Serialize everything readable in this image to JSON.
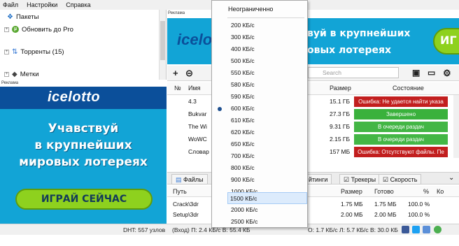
{
  "menu": [
    "Файл",
    "Настройки",
    "Справка"
  ],
  "sidebar": {
    "items": [
      {
        "label": "Пакеты"
      },
      {
        "label": "Обновить до Pro"
      },
      {
        "label": "Торренты (15)"
      },
      {
        "label": "Метки"
      }
    ]
  },
  "ads": {
    "label": "Реклама",
    "left": {
      "logo": "icelotto",
      "lines": [
        "Учавствуй",
        "в крупнейших",
        "мировых лотереях"
      ],
      "cta": "ИГРАЙ СЕЙЧАС"
    },
    "top": {
      "logo": "icelo",
      "line1": "вуй в крупнейших",
      "line2": "овых лотереях",
      "cta": "ИГ"
    }
  },
  "toolbar": {
    "search_placeholder": "Search"
  },
  "torrent_list": {
    "columns": [
      "№",
      "Имя",
      "Размер",
      "Состояние"
    ],
    "rows": [
      {
        "num": "",
        "name": "4.3",
        "size": "15.1 ГБ",
        "state": "Ошибка: Не удается найти указа",
        "kind": "err"
      },
      {
        "num": "",
        "name": "Bukvar",
        "size": "27.3 ГБ",
        "state": "Завершено",
        "kind": "ok"
      },
      {
        "num": "",
        "name": "The Wi",
        "size": "9.31 ГБ",
        "state": "В очереди раздач",
        "kind": "wait"
      },
      {
        "num": "",
        "name": "WoWC",
        "size": "2.15 ГБ",
        "state": "В очереди раздач",
        "kind": "wait"
      },
      {
        "num": "",
        "name": "Словар",
        "size": "157 МБ",
        "state": "Ошибка: Отсутствуют файлы. Пе",
        "kind": "err"
      }
    ]
  },
  "bottom_tabs": [
    "Файлы",
    "йтинги",
    "Трекеры",
    "Скорость"
  ],
  "files": {
    "columns": [
      "Путь",
      "Размер",
      "Готово",
      "%",
      "Ко"
    ],
    "rows": [
      {
        "path": "Crack\\3dr",
        "size": "1.75 МБ",
        "done": "1.75 МБ",
        "pct": "100.0 %"
      },
      {
        "path": "Setup\\3dr",
        "size": "2.00 МБ",
        "done": "2.00 МБ",
        "pct": "100.0 %"
      }
    ]
  },
  "statusbar": {
    "dht": "DHT: 557 узлов",
    "in": "(Вход) П: 2.4 КБ/с В: 55.4 КБ",
    "out": "О: 1.7 КБ/с Л: 5.7 КБ/с В: 30.0 КБ"
  },
  "speed_menu": {
    "items": [
      "Неограниченно",
      "200 КБ/с",
      "300 КБ/с",
      "400 КБ/с",
      "500 КБ/с",
      "550 КБ/с",
      "580 КБ/с",
      "590 КБ/с",
      "600 КБ/с",
      "610 КБ/с",
      "620 КБ/с",
      "650 КБ/с",
      "700 КБ/с",
      "800 КБ/с",
      "900 КБ/с",
      "1000 КБ/с",
      "1500 КБ/с",
      "2000 КБ/с",
      "2500 КБ/с"
    ],
    "selected": "600 КБ/с",
    "hovered": "1500 КБ/с"
  },
  "colors": {
    "ad_blue": "#12a4d6",
    "ad_dark": "#0b4f9a",
    "ad_green": "#8ed11e",
    "error_red": "#c21e1e",
    "ok_green": "#3ab13c"
  }
}
